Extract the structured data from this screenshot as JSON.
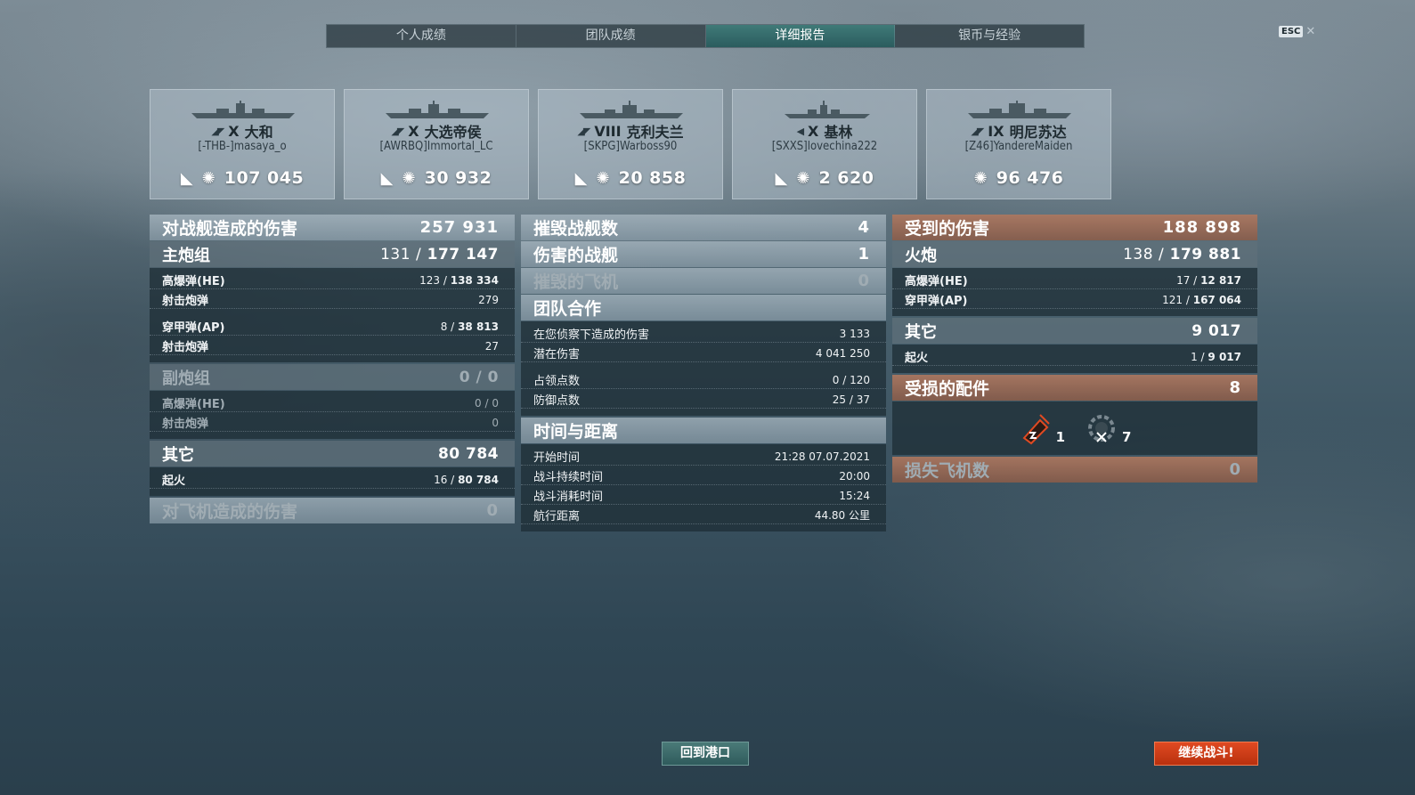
{
  "tabs": [
    "个人成绩",
    "团队成绩",
    "详细报告",
    "银币与经验"
  ],
  "active_tab": 2,
  "esc_label": "ESC",
  "ships": [
    {
      "tier": "X",
      "name": "大和",
      "player": "[-THB-]masaya_o",
      "damage": "107  045"
    },
    {
      "tier": "X",
      "name": "大选帝侯",
      "player": "[AWRBQ]Immortal_LC",
      "damage": "30  932"
    },
    {
      "tier": "VIII",
      "name": "克利夫兰",
      "player": "[SKPG]Warboss90",
      "damage": "20  858"
    },
    {
      "tier": "X",
      "name": "基林",
      "player": "[SXXS]lovechina222",
      "damage": "2  620"
    },
    {
      "tier": "IX",
      "name": "明尼苏达",
      "player": "[Z46]YandereMaiden",
      "damage": "96  476"
    }
  ],
  "left": {
    "ship_damage": {
      "label": "对战舰造成的伤害",
      "value": "257  931"
    },
    "main_battery": {
      "label": "主炮组",
      "hits": "131 /",
      "value": "177  147"
    },
    "main_he": {
      "label": "高爆弹(HE)",
      "hits": "123 /",
      "value": "138  334"
    },
    "main_he_shots": {
      "label": "射击炮弹",
      "value": "279"
    },
    "main_ap": {
      "label": "穿甲弹(AP)",
      "hits": "8 /",
      "value": "38  813"
    },
    "main_ap_shots": {
      "label": "射击炮弹",
      "value": "27"
    },
    "secondary": {
      "label": "副炮组",
      "value": "0 / 0"
    },
    "sec_he": {
      "label": "高爆弹(HE)",
      "value": "0 / 0"
    },
    "sec_shots": {
      "label": "射击炮弹",
      "value": "0"
    },
    "other": {
      "label": "其它",
      "value": "80  784"
    },
    "fire": {
      "label": "起火",
      "hits": "16 /",
      "value": "80  784"
    },
    "aircraft_damage": {
      "label": "对飞机造成的伤害",
      "value": "0"
    }
  },
  "middle": {
    "destroyed_ships": {
      "label": "摧毁战舰数",
      "value": "4"
    },
    "damaged_ships": {
      "label": "伤害的战舰",
      "value": "1"
    },
    "destroyed_planes": {
      "label": "摧毁的飞机",
      "value": "0"
    },
    "teamwork": {
      "label": "团队合作"
    },
    "spotting_damage": {
      "label": "在您侦察下造成的伤害",
      "value": "3  133"
    },
    "potential_damage": {
      "label": "潜在伤害",
      "value": "4  041  250"
    },
    "capture_points": {
      "label": "占领点数",
      "value": "0 / 120"
    },
    "defense_points": {
      "label": "防御点数",
      "value": "25 / 37"
    },
    "time_distance": {
      "label": "时间与距离"
    },
    "start_time": {
      "label": "开始时间",
      "value": "21:28     07.07.2021"
    },
    "battle_duration": {
      "label": "战斗持续时间",
      "value": "20:00"
    },
    "time_spent": {
      "label": "战斗消耗时间",
      "value": "15:24"
    },
    "distance": {
      "label": "航行距离",
      "value": "44.80  公里"
    }
  },
  "right": {
    "received_damage": {
      "label": "受到的伤害",
      "value": "188  898"
    },
    "guns": {
      "label": "火炮",
      "hits": "138 /",
      "value": "179  881"
    },
    "recv_he": {
      "label": "高爆弹(HE)",
      "hits": "17 /",
      "value": "12  817"
    },
    "recv_ap": {
      "label": "穿甲弹(AP)",
      "hits": "121 /",
      "value": "167  064"
    },
    "other": {
      "label": "其它",
      "value": "9  017"
    },
    "fire": {
      "label": "起火",
      "hits": "1 /",
      "value": "9  017"
    },
    "damaged_modules": {
      "label": "受损的配件",
      "value": "8"
    },
    "module_fire_count": "1",
    "module_broken_count": "7",
    "lost_planes": {
      "label": "损失飞机数",
      "value": "0"
    }
  },
  "buttons": {
    "port": "回到港口",
    "battle": "继续战斗!"
  }
}
